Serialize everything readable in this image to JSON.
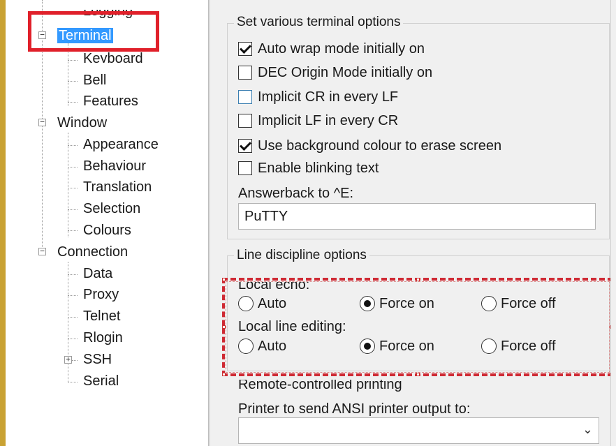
{
  "tree": {
    "items": [
      {
        "label": "Logging"
      },
      {
        "label": "Terminal"
      },
      {
        "label": "Keyboard"
      },
      {
        "label": "Bell"
      },
      {
        "label": "Features"
      },
      {
        "label": "Window"
      },
      {
        "label": "Appearance"
      },
      {
        "label": "Behaviour"
      },
      {
        "label": "Translation"
      },
      {
        "label": "Selection"
      },
      {
        "label": "Colours"
      },
      {
        "label": "Connection"
      },
      {
        "label": "Data"
      },
      {
        "label": "Proxy"
      },
      {
        "label": "Telnet"
      },
      {
        "label": "Rlogin"
      },
      {
        "label": "SSH"
      },
      {
        "label": "Serial"
      }
    ],
    "expander_minus": "−",
    "expander_plus": "+"
  },
  "terminal_options": {
    "title": "Set various terminal options",
    "checkboxes": [
      {
        "label": "Auto wrap mode initially on",
        "checked": true
      },
      {
        "label": "DEC Origin Mode initially on",
        "checked": false
      },
      {
        "label": "Implicit CR in every LF",
        "checked": false
      },
      {
        "label": "Implicit LF in every CR",
        "checked": false
      },
      {
        "label": "Use background colour to erase screen",
        "checked": true
      },
      {
        "label": "Enable blinking text",
        "checked": false
      }
    ],
    "answerback_label": "Answerback to ^E:",
    "answerback_value": "PuTTY"
  },
  "line_discipline": {
    "title": "Line discipline options",
    "local_echo_label": "Local echo:",
    "local_echo_options": [
      "Auto",
      "Force on",
      "Force off"
    ],
    "local_echo_selected": "Force on",
    "local_line_editing_label": "Local line editing:",
    "local_line_editing_options": [
      "Auto",
      "Force on",
      "Force off"
    ],
    "local_line_editing_selected": "Force on"
  },
  "remote_printing": {
    "title": "Remote-controlled printing",
    "printer_label": "Printer to send ANSI printer output to:",
    "printer_value": ""
  },
  "colors": {
    "highlight_red": "#e0202a",
    "selection_blue": "#3399ff"
  }
}
